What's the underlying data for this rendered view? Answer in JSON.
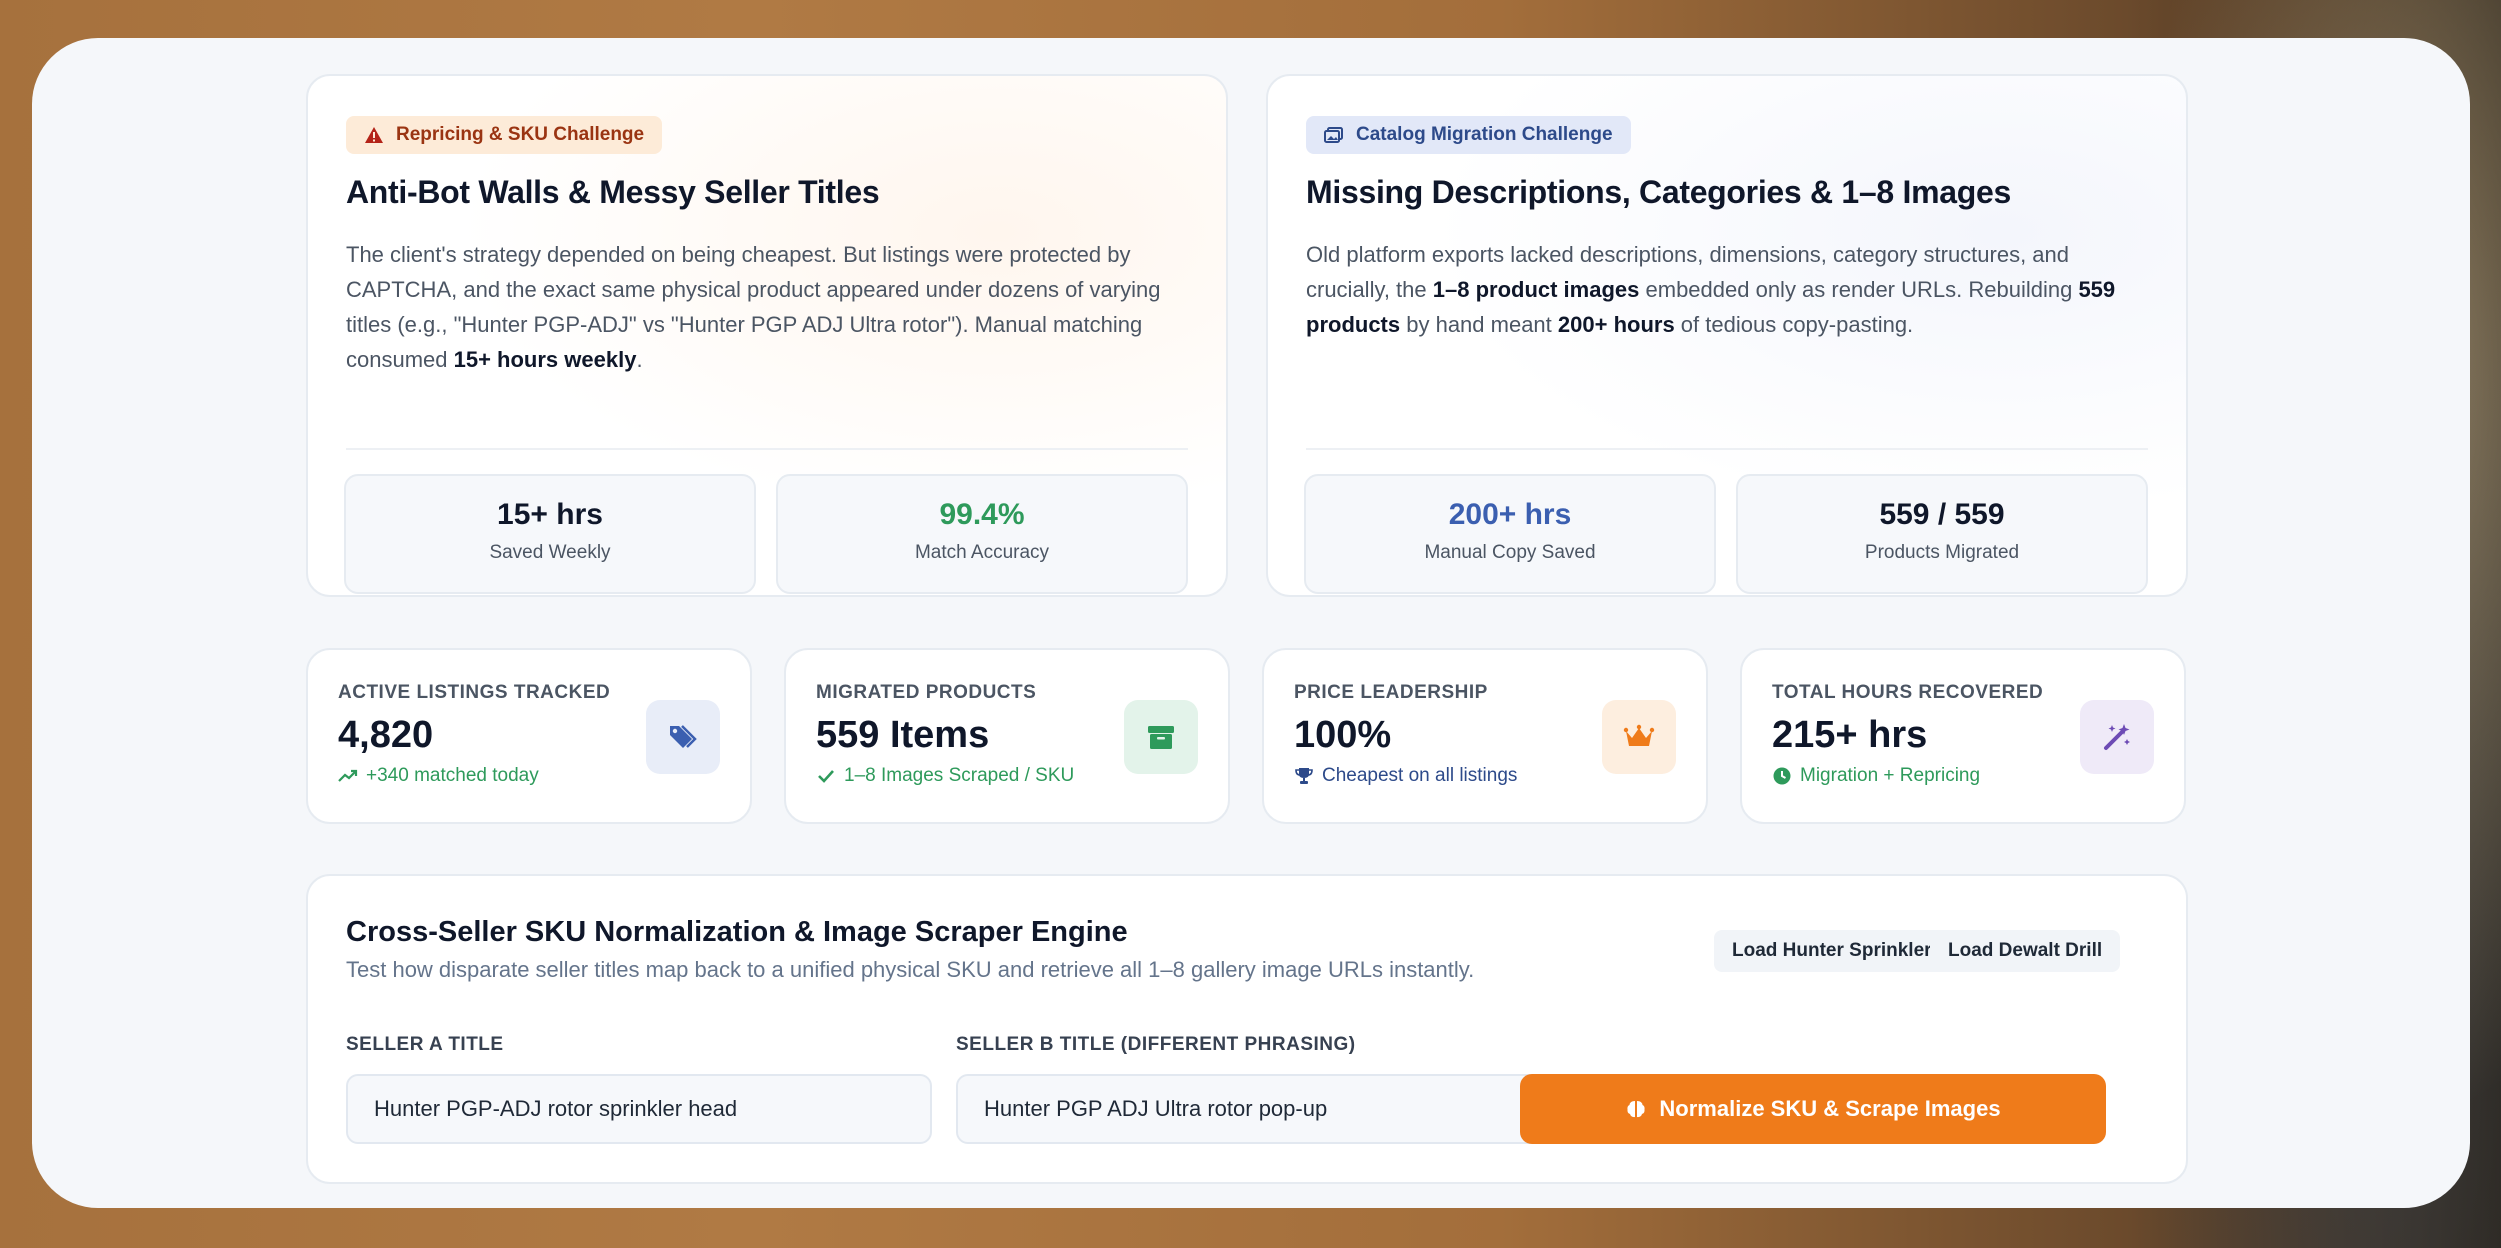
{
  "challenges": {
    "left": {
      "tag": "Repricing & SKU Challenge",
      "title": "Anti-Bot Walls & Messy Seller Titles",
      "body_1": "The client's strategy depended on being cheapest. But listings were protected by CAPTCHA, and the exact same physical product appeared under dozens of varying titles (e.g., \"Hunter PGP-ADJ\" vs \"Hunter PGP ADJ Ultra rotor\"). Manual matching consumed ",
      "body_bold": "15+ hours weekly",
      "body_2": ".",
      "stats": [
        {
          "value": "15+ hrs",
          "label": "Saved Weekly",
          "color": "#0f172a"
        },
        {
          "value": "99.4%",
          "label": "Match Accuracy",
          "color": "#2e9a5b"
        }
      ]
    },
    "right": {
      "tag": "Catalog Migration Challenge",
      "title": "Missing Descriptions, Categories & 1–8 Images",
      "body_1": "Old platform exports lacked descriptions, dimensions, category structures, and crucially, the ",
      "body_bold_1": "1–8 product images",
      "body_2": " embedded only as render URLs. Rebuilding ",
      "body_bold_2": "559 products",
      "body_3": " by hand meant ",
      "body_bold_3": "200+ hours",
      "body_4": " of tedious copy-pasting.",
      "stats": [
        {
          "value": "200+ hrs",
          "label": "Manual Copy Saved",
          "color": "#3b5fb0"
        },
        {
          "value": "559 / 559",
          "label": "Products Migrated",
          "color": "#0f172a"
        }
      ]
    }
  },
  "metrics": [
    {
      "label": "ACTIVE LISTINGS TRACKED",
      "value": "4,820",
      "sub": "+340 matched today",
      "icon": "tags-icon"
    },
    {
      "label": "MIGRATED PRODUCTS",
      "value": "559 Items",
      "sub": "1–8 Images Scraped / SKU",
      "icon": "archive-icon"
    },
    {
      "label": "PRICE LEADERSHIP",
      "value": "100%",
      "sub": "Cheapest on all listings",
      "icon": "crown-icon"
    },
    {
      "label": "TOTAL HOURS RECOVERED",
      "value": "215+ hrs",
      "sub": "Migration + Repricing",
      "icon": "magic-wand-icon"
    }
  ],
  "engine": {
    "title": "Cross-Seller SKU Normalization & Image Scraper Engine",
    "subtitle": "Test how disparate seller titles map back to a unified physical SKU and retrieve all 1–8 gallery image URLs instantly.",
    "preset_1": "Load Hunter Sprinkler",
    "preset_2": "Load Dewalt Drill",
    "seller_a_label": "SELLER A TITLE",
    "seller_a_value": "Hunter PGP-ADJ rotor sprinkler head",
    "seller_b_label": "SELLER B TITLE (DIFFERENT PHRASING)",
    "seller_b_value": "Hunter PGP ADJ Ultra rotor pop-up",
    "action": "Normalize SKU & Scrape Images"
  },
  "colors": {
    "accent_orange": "#ef7b1a",
    "success_green": "#2e9a5b",
    "brand_blue": "#3b5fb0"
  }
}
